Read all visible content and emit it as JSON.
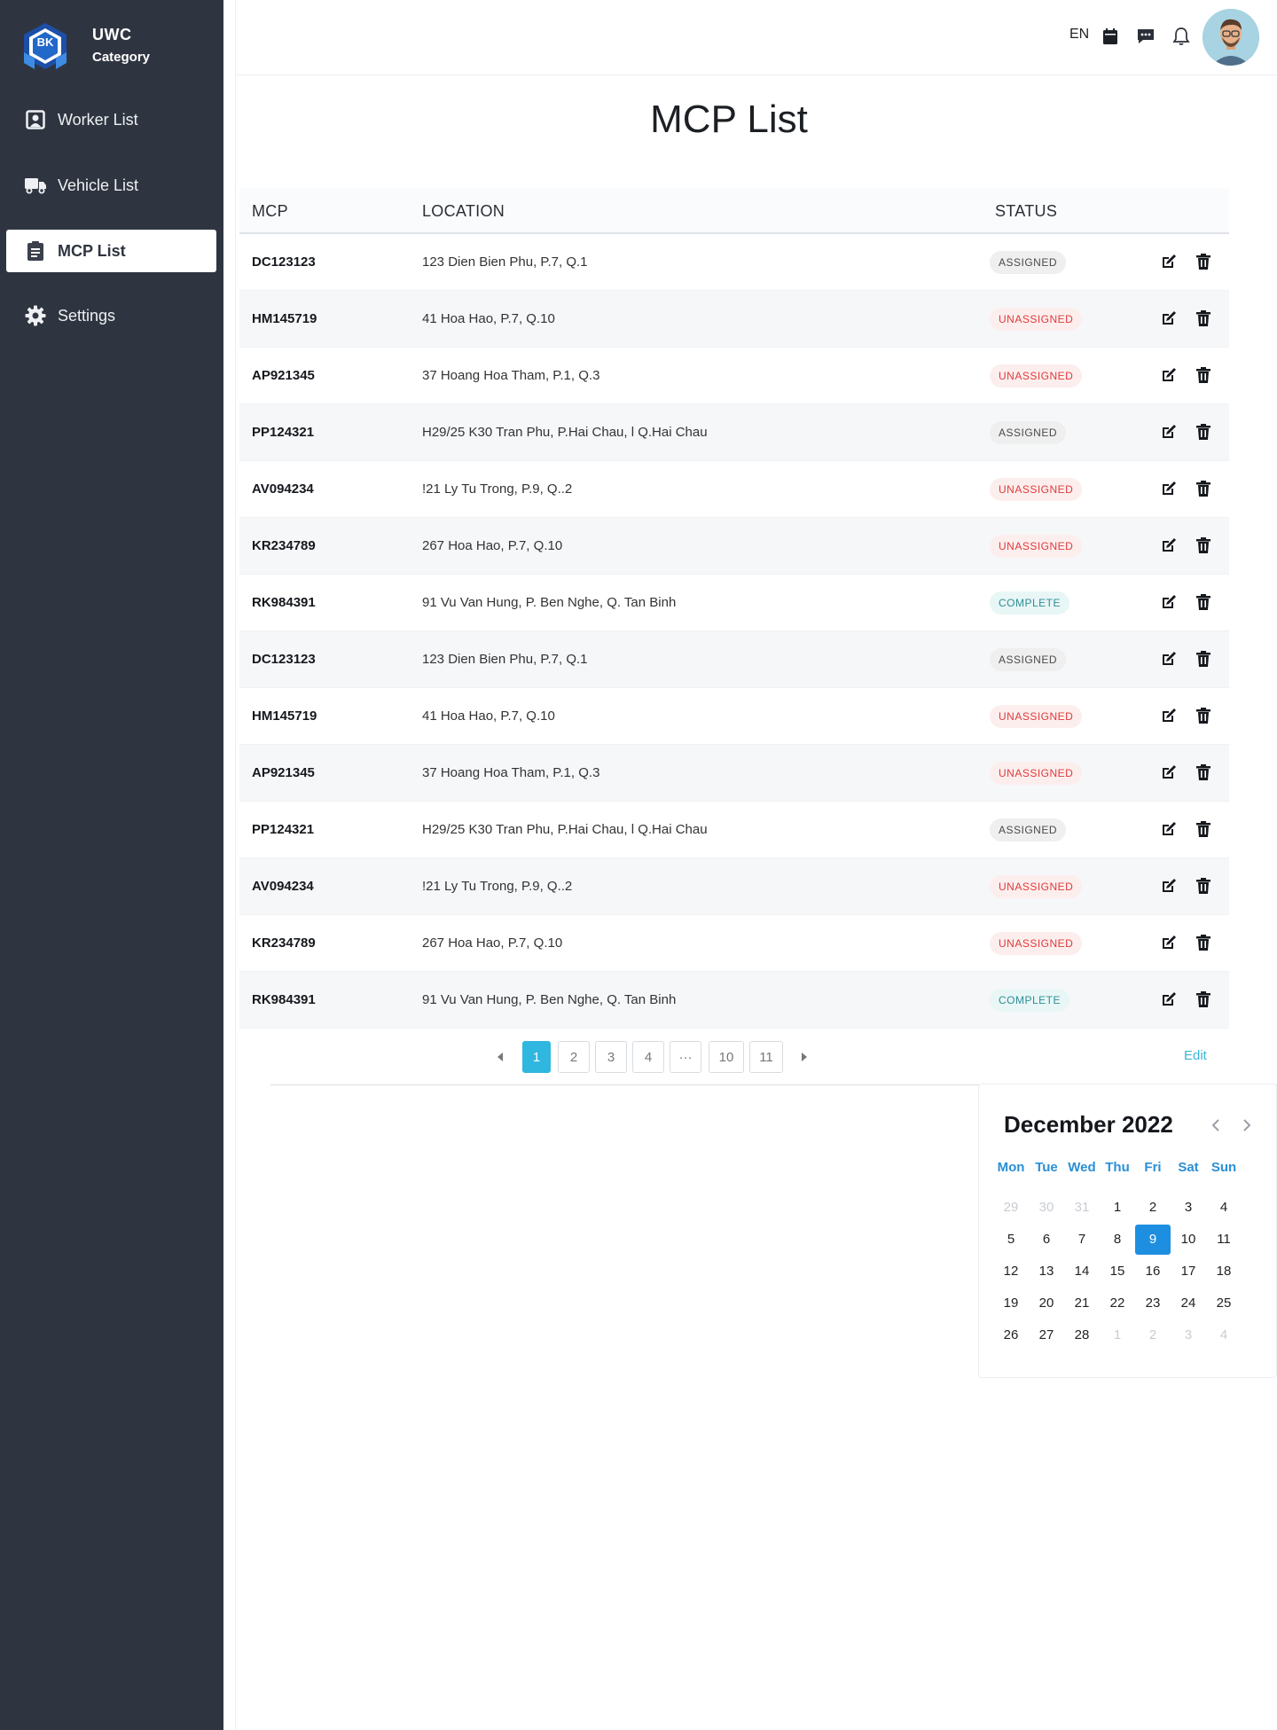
{
  "brand": {
    "badge": "BK",
    "title": "UWC",
    "subtitle": "Category"
  },
  "sidebar": {
    "items": [
      {
        "label": "Worker List",
        "icon": "worker-icon"
      },
      {
        "label": "Vehicle List",
        "icon": "truck-icon"
      },
      {
        "label": "MCP List",
        "icon": "clipboard-icon",
        "active": true
      },
      {
        "label": "Settings",
        "icon": "gear-icon"
      }
    ]
  },
  "header": {
    "lang": "EN",
    "icons": [
      "calendar-icon",
      "chat-icon",
      "bell-icon"
    ]
  },
  "page": {
    "title": "MCP List"
  },
  "table": {
    "columns": [
      "MCP",
      "LOCATION",
      "STATUS"
    ],
    "rows": [
      {
        "mcp": "DC123123",
        "location": "123 Dien Bien Phu, P.7, Q.1",
        "status": "ASSIGNED"
      },
      {
        "mcp": "HM145719",
        "location": "41 Hoa Hao, P.7, Q.10",
        "status": "UNASSIGNED"
      },
      {
        "mcp": "AP921345",
        "location": "37 Hoang Hoa Tham, P.1, Q.3",
        "status": "UNASSIGNED"
      },
      {
        "mcp": "PP124321",
        "location": "H29/25 K30 Tran Phu, P.Hai Chau, l  Q.Hai Chau",
        "status": "ASSIGNED"
      },
      {
        "mcp": "AV094234",
        "location": "!21 Ly  Tu Trong, P.9, Q..2",
        "status": "UNASSIGNED"
      },
      {
        "mcp": "KR234789",
        "location": "267 Hoa Hao, P.7, Q.10",
        "status": "UNASSIGNED"
      },
      {
        "mcp": "RK984391",
        "location": "91 Vu Van Hung, P. Ben Nghe, Q.  Tan Binh",
        "status": "COMPLETE"
      },
      {
        "mcp": "DC123123",
        "location": "123 Dien Bien Phu, P.7, Q.1",
        "status": "ASSIGNED"
      },
      {
        "mcp": "HM145719",
        "location": "41 Hoa Hao, P.7, Q.10",
        "status": "UNASSIGNED"
      },
      {
        "mcp": "AP921345",
        "location": "37 Hoang Hoa Tham, P.1, Q.3",
        "status": "UNASSIGNED"
      },
      {
        "mcp": "PP124321",
        "location": "H29/25 K30 Tran Phu, P.Hai Chau, l  Q.Hai Chau",
        "status": "ASSIGNED"
      },
      {
        "mcp": "AV094234",
        "location": "!21 Ly  Tu Trong, P.9, Q..2",
        "status": "UNASSIGNED"
      },
      {
        "mcp": "KR234789",
        "location": "267 Hoa Hao, P.7, Q.10",
        "status": "UNASSIGNED"
      },
      {
        "mcp": "RK984391",
        "location": "91 Vu Van Hung, P. Ben Nghe, Q.  Tan Binh",
        "status": "COMPLETE"
      }
    ]
  },
  "pagination": {
    "pages": [
      "1",
      "2",
      "3",
      "4",
      "···",
      "10",
      "11"
    ],
    "current": "1",
    "edit_label": "Edit"
  },
  "calendar": {
    "title": "December 2022",
    "weekdays": [
      "Mon",
      "Tue",
      "Wed",
      "Thu",
      "Fri",
      "Sat",
      "Sun"
    ],
    "days": [
      [
        "29",
        "30",
        "31",
        "1",
        "2",
        "3",
        "4"
      ],
      [
        "5",
        "6",
        "7",
        "8",
        "9",
        "10",
        "11"
      ],
      [
        "12",
        "13",
        "14",
        "15",
        "16",
        "17",
        "18"
      ],
      [
        "19",
        "20",
        "21",
        "22",
        "23",
        "24",
        "25"
      ],
      [
        "26",
        "27",
        "28",
        "1",
        "2",
        "3",
        "4"
      ]
    ],
    "selected": "9"
  },
  "colors": {
    "sidebar": "#2f3540",
    "accent": "#2fb7e0",
    "calendar_accent": "#1e8fe0",
    "danger": "#e03a3a",
    "complete": "#2e8e96"
  }
}
